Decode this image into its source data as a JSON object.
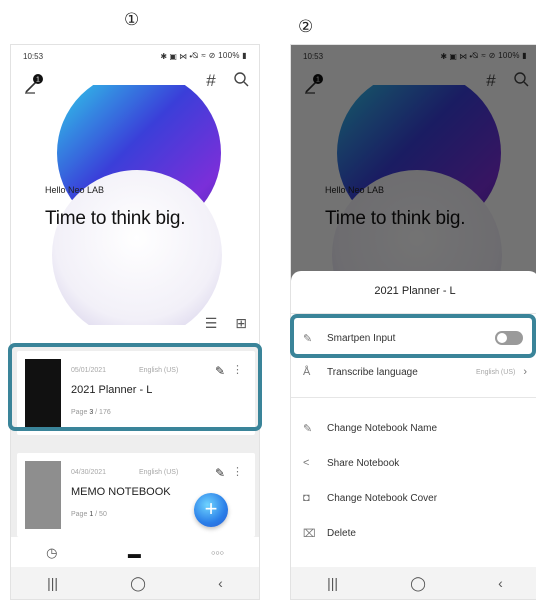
{
  "markers": {
    "first": "①",
    "second": "②"
  },
  "status_bar": {
    "time": "10:53",
    "left_icons": "✱ ▣ ⋈ •",
    "right_icons": "⦰ ≈ ⊘ 100% ▮"
  },
  "header": {
    "notification_count": "1",
    "grid_icon_glyph": "#",
    "search_icon_glyph": "⌕"
  },
  "hero": {
    "greeting": "Hello Neo LAB",
    "title": "Time to think big."
  },
  "view_toggle": {
    "list_glyph": "☰",
    "grid_glyph": "⊞"
  },
  "notebooks": [
    {
      "date": "05/01/2021",
      "language": "English (US)",
      "title": "2021 Planner - L",
      "page_label": "Page",
      "page_current": "3",
      "page_total": "/ 176",
      "cover_color": "#111111"
    },
    {
      "date": "04/30/2021",
      "language": "English (US)",
      "title": "MEMO NOTEBOOK",
      "page_label": "Page",
      "page_current": "1",
      "page_total": "/ 50",
      "cover_color": "#8e8e8e"
    }
  ],
  "fab": {
    "glyph": "+"
  },
  "bottom_tabs": {
    "recent_glyph": "◷",
    "notebooks_glyph": "▬",
    "more_glyph": "○○○"
  },
  "nav_bar": {
    "recents": "|||",
    "home": "◯",
    "back": "‹"
  },
  "sheet": {
    "title": "2021 Planner - L",
    "items": [
      {
        "icon": "✎",
        "label": "Smartpen Input",
        "toggle": false
      },
      {
        "icon": "Å",
        "label": "Transcribe language",
        "value": "English (US)",
        "chevron": "›"
      },
      {
        "icon": "✎",
        "label": "Change Notebook Name"
      },
      {
        "icon": "<",
        "label": "Share Notebook"
      },
      {
        "icon": "◘",
        "label": "Change Notebook Cover"
      },
      {
        "icon": "⌧",
        "label": "Delete"
      }
    ]
  },
  "colors": {
    "highlight": "#3a8499",
    "fab": "#2a7ee8",
    "dim_overlay": "rgba(0,0,0,0.55)"
  }
}
